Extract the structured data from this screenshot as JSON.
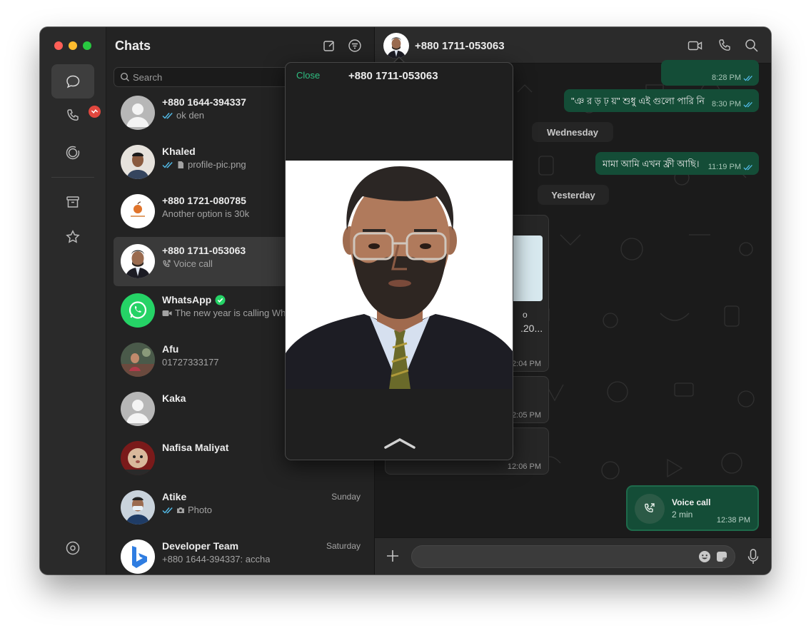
{
  "chats_panel": {
    "title": "Chats",
    "search_placeholder": "Search",
    "items": [
      {
        "name": "+880 1644-394337",
        "subtitle": "ok den",
        "time": "",
        "read_ticks": true,
        "icon": "",
        "verified": false
      },
      {
        "name": "Khaled",
        "subtitle": "profile-pic.png",
        "time": "",
        "read_ticks": true,
        "icon": "document-icon",
        "verified": false
      },
      {
        "name": "+880 1721-080785",
        "subtitle": "Another option is 30k",
        "time": "",
        "read_ticks": false,
        "icon": "",
        "verified": false
      },
      {
        "name": "+880 1711-053063",
        "subtitle": "Voice call",
        "time": "",
        "read_ticks": false,
        "icon": "phone-outgoing-icon",
        "verified": false,
        "selected": true
      },
      {
        "name": "WhatsApp",
        "subtitle": "The new year is calling Wh",
        "time": "",
        "read_ticks": false,
        "icon": "video-icon",
        "verified": true
      },
      {
        "name": "Afu",
        "subtitle": "01727333177",
        "time": "",
        "read_ticks": false,
        "icon": "",
        "verified": false
      },
      {
        "name": "Kaka",
        "subtitle": "",
        "time": "",
        "read_ticks": false,
        "icon": "",
        "verified": false
      },
      {
        "name": "Nafisa Maliyat",
        "subtitle": "",
        "time": "",
        "read_ticks": false,
        "icon": "",
        "verified": false
      },
      {
        "name": "Atike",
        "subtitle": "Photo",
        "time": "Sunday",
        "read_ticks": true,
        "icon": "camera-icon",
        "verified": false
      },
      {
        "name": "Developer Team",
        "subtitle": "+880 1644-394337: accha",
        "time": "Saturday",
        "read_ticks": false,
        "icon": "",
        "verified": false
      }
    ]
  },
  "conversation": {
    "contact": "+880 1711-053063",
    "messages": [
      {
        "text": "",
        "time": "8:28 PM"
      },
      {
        "text": "\"ঞ র ড় ঢ় য়\" শুধু এই গুলো পারি নি",
        "time": "8:30 PM"
      },
      {
        "date": "Wednesday"
      },
      {
        "text": "মামা আমি এখন ফ্রী আছি।",
        "time": "11:19 PM"
      },
      {
        "date": "Yesterday"
      }
    ],
    "incoming_fragments": {
      "caption": "o",
      "link": ".20...",
      "times": [
        "2:04 PM",
        "2:05 PM",
        "12:06 PM"
      ]
    },
    "call": {
      "title": "Voice call",
      "duration": "2 min",
      "time": "12:38 PM"
    },
    "composer_placeholder": ""
  },
  "popover": {
    "close_label": "Close",
    "title": "+880 1711-053063"
  },
  "colors": {
    "accent": "#2fbf82",
    "outgoing_bubble": "#144d37",
    "read_ticks": "#53bdeb",
    "badge": "#e1473e"
  }
}
